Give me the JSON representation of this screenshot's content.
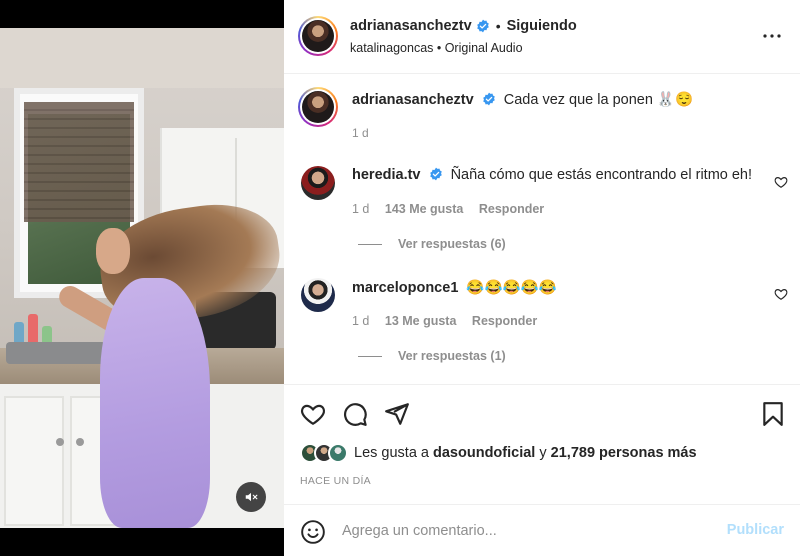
{
  "colors": {
    "accent": "#0095f6",
    "verified": "#3897f0",
    "muted_text": "#8e8e8e",
    "publish_disabled": "#b2dffc"
  },
  "header": {
    "username": "adrianasancheztv",
    "separator": "•",
    "follow_status": "Siguiendo",
    "subtitle": "katalinagoncas • Original Audio",
    "more_icon": "more-horizontal-icon"
  },
  "caption": {
    "username": "adrianasancheztv",
    "text": "Cada vez que la ponen 🐰😌",
    "time": "1 d"
  },
  "comments": [
    {
      "username": "heredia.tv",
      "verified": true,
      "text": "Ñaña cómo que estás encontrando el ritmo eh!",
      "time": "1 d",
      "likes": "143 Me gusta",
      "reply_label": "Responder",
      "view_replies": "Ver respuestas (6)"
    },
    {
      "username": "marceloponce1",
      "verified": false,
      "text": "😂😂😂😂😂",
      "time": "1 d",
      "likes": "13 Me gusta",
      "reply_label": "Responder",
      "view_replies": "Ver respuestas (1)"
    }
  ],
  "actions": {
    "icons": [
      "heart-icon",
      "comment-icon",
      "share-icon",
      "bookmark-icon"
    ]
  },
  "likes": {
    "prefix": "Les gusta a",
    "user": "dasoundoficial",
    "connector": "y",
    "others": "21,789 personas más"
  },
  "time_ago": "HACE UN DÍA",
  "comment_box": {
    "placeholder": "Agrega un comentario...",
    "publish_label": "Publicar"
  },
  "media": {
    "mute_icon": "muted-speaker-icon"
  }
}
